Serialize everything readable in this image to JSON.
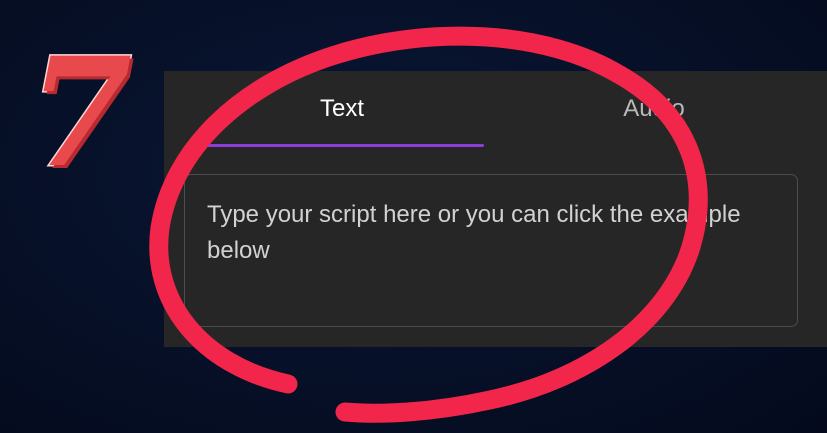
{
  "step_number": "7",
  "tabs": [
    {
      "label": "Text",
      "active": true
    },
    {
      "label": "Audio",
      "active": false
    }
  ],
  "script_input": {
    "placeholder": "Type your script here or you can click the example below"
  },
  "colors": {
    "background": "#07112a",
    "panel": "#262626",
    "tab_indicator": "#8b3fd6",
    "annotation": "#f2254a",
    "step_number": "#e8494d"
  }
}
